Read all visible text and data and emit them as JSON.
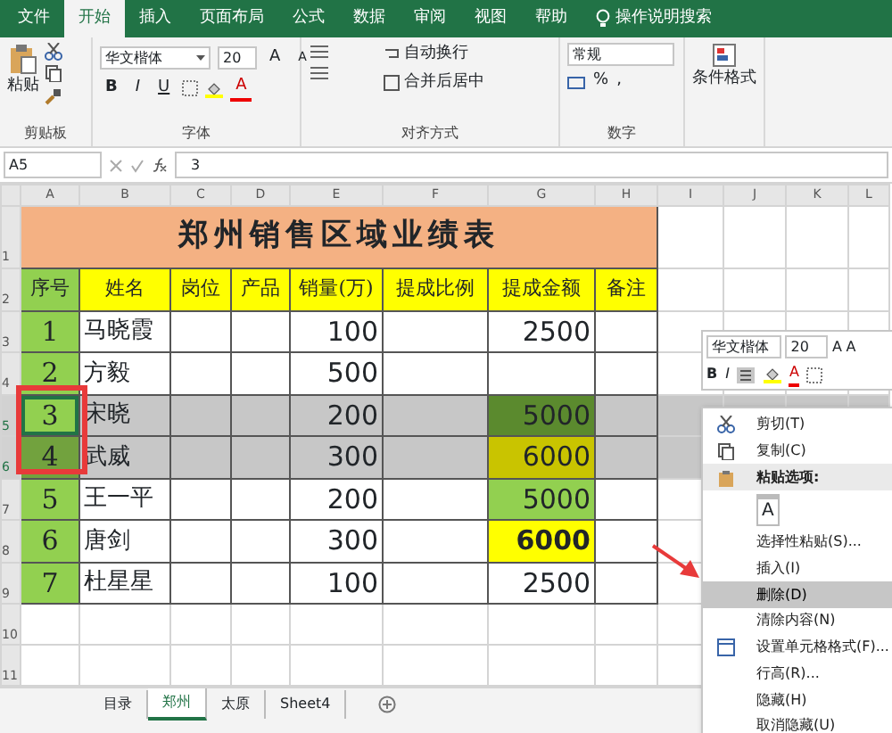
{
  "menu_tabs": [
    {
      "label": "文件",
      "selected": false
    },
    {
      "label": "开始",
      "selected": true
    },
    {
      "label": "插入",
      "selected": false
    },
    {
      "label": "页面布局",
      "selected": false
    },
    {
      "label": "公式",
      "selected": false
    },
    {
      "label": "数据",
      "selected": false
    },
    {
      "label": "审阅",
      "selected": false
    },
    {
      "label": "视图",
      "selected": false
    },
    {
      "label": "帮助",
      "selected": false
    }
  ],
  "tell_me": "操作说明搜索",
  "ribbon": {
    "clipboard": {
      "paste": "粘贴",
      "label": "剪贴板"
    },
    "font": {
      "name": "华文楷体",
      "size": "20",
      "grow": "A",
      "shrink": "A",
      "bold": "B",
      "italic": "I",
      "underline": "U",
      "font_color": "A",
      "label": "字体"
    },
    "alignment": {
      "wrap": "自动换行",
      "merge": "合并后居中",
      "label": "对齐方式"
    },
    "number": {
      "format": "常规",
      "percent": "%",
      "comma": ",",
      "label": "数字"
    },
    "styles": {
      "conditional": "条件格式"
    }
  },
  "formula_bar": {
    "name_box": "A5",
    "value": "3"
  },
  "columns": [
    "A",
    "B",
    "C",
    "D",
    "E",
    "F",
    "G",
    "H",
    "I",
    "J",
    "K",
    "L"
  ],
  "row_numbers": [
    "1",
    "2",
    "3",
    "4",
    "5",
    "6",
    "7",
    "8",
    "9",
    "10",
    "11"
  ],
  "title": "郑州销售区域业绩表",
  "headers": [
    "序号",
    "姓名",
    "岗位",
    "产品",
    "销量(万)",
    "提成比例",
    "提成金额",
    "备注"
  ],
  "rows": [
    {
      "selected": false,
      "active": false,
      "color": "#ffffff",
      "amount_bold": false,
      "cells": [
        "1",
        "马晓霞",
        "",
        "",
        "100",
        "",
        "2500",
        ""
      ]
    },
    {
      "selected": false,
      "active": false,
      "color": "#ffffff",
      "cells": [
        "2",
        "方毅",
        "",
        "",
        "500",
        "",
        "",
        ""
      ]
    },
    {
      "selected": true,
      "active": true,
      "color": "#5b8a2e",
      "amount_bold": false,
      "cells": [
        "3",
        "宋晓",
        "",
        "",
        "200",
        "",
        "5000",
        ""
      ]
    },
    {
      "selected": true,
      "active": false,
      "color": "#c9c400",
      "amount_bold": false,
      "cells": [
        "4",
        "武威",
        "",
        "",
        "300",
        "",
        "6000",
        ""
      ]
    },
    {
      "selected": false,
      "active": false,
      "color": "#92d050",
      "amount_bold": false,
      "cells": [
        "5",
        "王一平",
        "",
        "",
        "200",
        "",
        "5000",
        ""
      ]
    },
    {
      "selected": false,
      "active": false,
      "color": "#ffff00",
      "amount_bold": true,
      "cells": [
        "6",
        "唐剑",
        "",
        "",
        "300",
        "",
        "6000",
        ""
      ]
    },
    {
      "selected": false,
      "active": false,
      "color": "#ffffff",
      "amount_bold": false,
      "cells": [
        "7",
        "杜星星",
        "",
        "",
        "100",
        "",
        "2500",
        ""
      ]
    }
  ],
  "sheet_tabs": [
    {
      "label": "目录",
      "selected": false
    },
    {
      "label": "郑州",
      "selected": true
    },
    {
      "label": "太原",
      "selected": false
    },
    {
      "label": "Sheet4",
      "selected": false
    }
  ],
  "mini_toolbar": {
    "font": "华文楷体",
    "size": "20",
    "grow": "A",
    "shrink": "A",
    "bold": "B",
    "italic": "I",
    "font_color": "A"
  },
  "context_menu": [
    {
      "kind": "item",
      "label": "剪切(T)",
      "selected": false
    },
    {
      "kind": "item",
      "label": "复制(C)",
      "selected": false
    },
    {
      "kind": "header",
      "label": "粘贴选项:"
    },
    {
      "kind": "paste",
      "label": "A"
    },
    {
      "kind": "item",
      "label": "选择性粘贴(S)...",
      "selected": false
    },
    {
      "kind": "item",
      "label": "插入(I)",
      "selected": false
    },
    {
      "kind": "item",
      "label": "删除(D)",
      "selected": true
    },
    {
      "kind": "item",
      "label": "清除内容(N)",
      "selected": false
    },
    {
      "kind": "item",
      "label": "设置单元格格式(F)...",
      "selected": false
    },
    {
      "kind": "item",
      "label": "行高(R)...",
      "selected": false
    },
    {
      "kind": "item",
      "label": "隐藏(H)",
      "selected": false
    },
    {
      "kind": "item",
      "label": "取消隐藏(U)",
      "selected": false
    }
  ]
}
